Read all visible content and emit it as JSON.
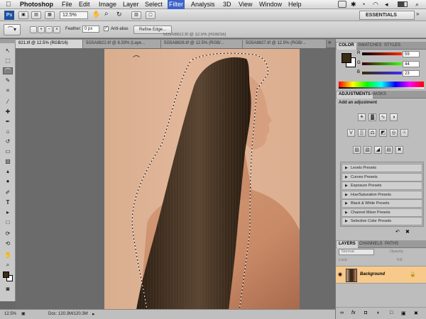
{
  "menubar": {
    "apple_icon": "apple-logo-icon",
    "app_name": "Photoshop",
    "items": [
      "File",
      "Edit",
      "Image",
      "Layer",
      "Select",
      "Filter",
      "Analysis",
      "3D",
      "View",
      "Window",
      "Help"
    ],
    "selected": "Filter"
  },
  "appbar": {
    "logo": "Ps",
    "zoom": "12.5%",
    "workspace": "ESSENTIALS"
  },
  "options": {
    "feather_label": "Feather:",
    "feather_value": "0 px",
    "anti_alias_label": "Anti-alias",
    "anti_alias_checked": true,
    "refine_edge_label": "Refine Edge..."
  },
  "document": {
    "window_title": "5G5A8822.tif @ 12.5% (RGB/16)",
    "tabs": [
      {
        "label": "821.tif @ 12.5% (RGB/16)",
        "active": true
      },
      {
        "label": "5G5A8822.tif @ 8.33% (Laye...",
        "active": false
      },
      {
        "label": "5G5A8826.tif @ 12.5% (RGB/...",
        "active": false
      },
      {
        "label": "5G5A8827.tif @ 12.5% (RGB/...",
        "active": false
      }
    ]
  },
  "status": {
    "zoom": "12.5%",
    "doc_size": "Doc: 120.3M/120.3M"
  },
  "color_panel": {
    "tabs": [
      "COLOR",
      "SWATCHES",
      "STYLES"
    ],
    "channels": [
      {
        "label": "R",
        "value": "59",
        "color": "#c82020"
      },
      {
        "label": "G",
        "value": "44",
        "color": "#2a9a2a"
      },
      {
        "label": "B",
        "value": "23",
        "color": "#2a3ac8"
      }
    ],
    "foreground": "#3b2c17",
    "background": "#ffffff"
  },
  "adjustments_panel": {
    "tabs": [
      "ADJUSTMENTS",
      "MASKS"
    ],
    "heading": "Add an adjustment",
    "presets": [
      "Levels Presets",
      "Curves Presets",
      "Exposure Presets",
      "Hue/Saturation Presets",
      "Black & White Presets",
      "Channel Mixer Presets",
      "Selective Color Presets"
    ]
  },
  "layers_panel": {
    "tabs": [
      "LAYERS",
      "CHANNELS",
      "PATHS"
    ],
    "blend_mode": "Normal",
    "opacity_label": "Opacity:",
    "lock_label": "Lock:",
    "fill_label": "Fill:",
    "layers": [
      {
        "name": "Background",
        "selected": true
      }
    ],
    "selected_color": "#f7c98a"
  },
  "colors": {
    "menu_highlight": "#3b64c8",
    "layer_selected": "#f7c98a",
    "hair": "#3a2a1c",
    "skin": "#e1b193",
    "backdrop": "#dcb092"
  }
}
